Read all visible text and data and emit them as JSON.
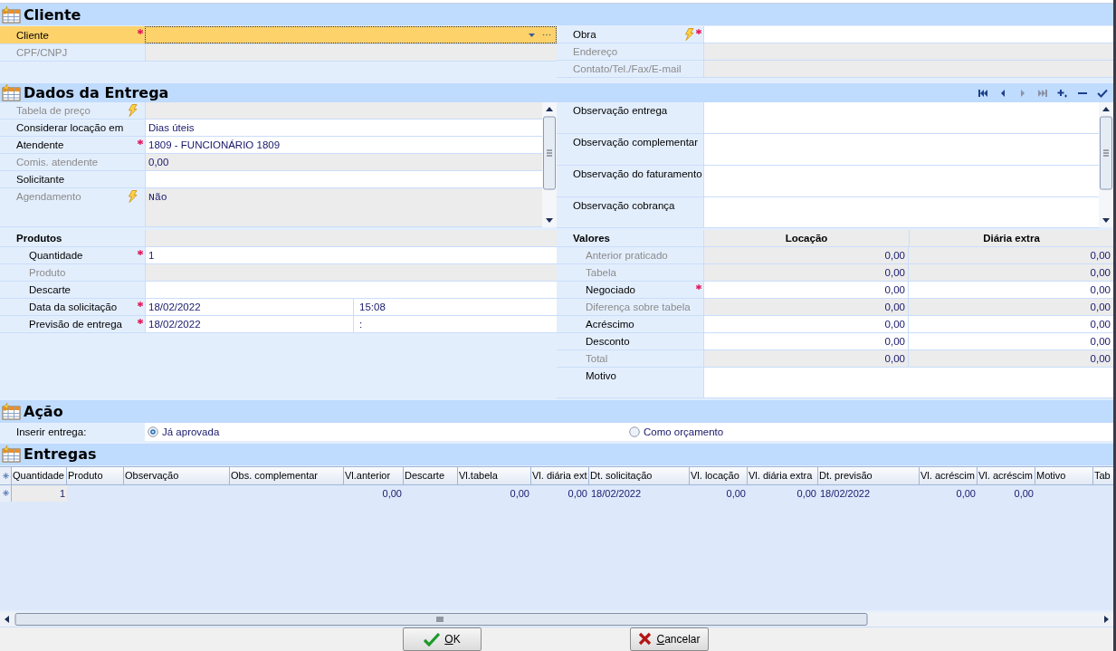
{
  "cliente": {
    "title": "Cliente",
    "left": [
      {
        "label": "Cliente",
        "kind": "lookup",
        "required": true,
        "action": false,
        "disabled": false,
        "focused": true
      },
      {
        "label": "CPF/CNPJ",
        "required": false,
        "action": false,
        "disabled": true,
        "focused": false
      }
    ],
    "right": [
      {
        "label": "Obra",
        "required": true,
        "action": true,
        "disabled": false
      },
      {
        "label": "Endereço",
        "required": false,
        "action": false,
        "disabled": true
      },
      {
        "label": "Contato/Tel./Fax/E-mail",
        "required": false,
        "action": false,
        "disabled": true
      }
    ]
  },
  "entrega": {
    "title": "Dados da Entrega",
    "navigator": [
      {
        "kind": "first",
        "disabled": false
      },
      {
        "kind": "prior",
        "disabled": false
      },
      {
        "kind": "next",
        "disabled": true
      },
      {
        "kind": "last",
        "disabled": true
      },
      {
        "kind": "insert",
        "disabled": false
      },
      {
        "kind": "delete",
        "disabled": false
      },
      {
        "kind": "post",
        "disabled": false
      }
    ],
    "left": [
      {
        "label": "Tabela de preço",
        "required": false,
        "action": true,
        "disabled": true
      },
      {
        "label": "Considerar locação em",
        "value": "Dias úteis",
        "required": false,
        "action": false,
        "disabled": false
      },
      {
        "label": "Atendente",
        "value": "1809 - FUNCIONÁRIO  1809",
        "required": true,
        "action": false,
        "disabled": false
      },
      {
        "label": "Comis. atendente",
        "value": "0,00",
        "required": false,
        "action": false,
        "disabled": true
      },
      {
        "label": "Solicitante",
        "required": false,
        "action": false,
        "disabled": false
      },
      {
        "label": "Agendamento",
        "value": "Não",
        "kind": "memo",
        "required": false,
        "action": true,
        "disabled": true
      }
    ],
    "right": [
      {
        "label": "Observação entrega"
      },
      {
        "label": "Observação complementar"
      },
      {
        "label": "Observação do faturamento"
      },
      {
        "label": "Observação cobrança"
      }
    ],
    "produtos": {
      "title": "Produtos",
      "rows": [
        {
          "label": "Quantidade",
          "value": "1",
          "required": true,
          "disabled": false
        },
        {
          "label": "Produto",
          "required": false,
          "disabled": true
        },
        {
          "label": "Descarte",
          "required": false,
          "disabled": false
        },
        {
          "label": "Data da solicitação",
          "value": "18/02/2022",
          "time": "15:08",
          "required": true,
          "disabled": false
        },
        {
          "label": "Previsão de entrega",
          "value": "18/02/2022",
          "time": ":",
          "required": true,
          "disabled": false
        }
      ]
    },
    "valores": {
      "title": "Valores",
      "columns": [
        "Locação",
        "Diária extra"
      ],
      "rows": [
        {
          "label": "Anterior praticado",
          "values": [
            "0,00",
            "0,00"
          ],
          "required": false,
          "disabled": true
        },
        {
          "label": "Tabela",
          "values": [
            "0,00",
            "0,00"
          ],
          "required": false,
          "disabled": true
        },
        {
          "label": "Negociado",
          "values": [
            "0,00",
            "0,00"
          ],
          "required": true,
          "disabled": false
        },
        {
          "label": "Diferença sobre tabela",
          "values": [
            "0,00",
            "0,00"
          ],
          "required": false,
          "disabled": true
        },
        {
          "label": "Acréscimo",
          "values": [
            "0,00",
            "0,00"
          ],
          "required": false,
          "disabled": false
        },
        {
          "label": "Desconto",
          "values": [
            "0,00",
            "0,00"
          ],
          "required": false,
          "disabled": false
        },
        {
          "label": "Total",
          "values": [
            "0,00",
            "0,00"
          ],
          "required": false,
          "disabled": true
        },
        {
          "label": "Motivo",
          "kind": "memo",
          "required": false,
          "disabled": false
        }
      ]
    }
  },
  "acao": {
    "title": "Ação",
    "label": "Inserir entrega:",
    "options": [
      {
        "label": "Já aprovada",
        "selected": true
      },
      {
        "label": "Como orçamento",
        "selected": false
      }
    ]
  },
  "entregas": {
    "title": "Entregas",
    "columns": [
      "Quantidade",
      "Produto",
      "Observação",
      "Obs. complementar",
      "Vl.anterior",
      "Descarte",
      "Vl.tabela",
      "Vl. diária ext",
      "Dt. solicitação",
      "Vl. locação",
      "Vl. diária extra",
      "Dt. previsão",
      "Vl. acréscim",
      "Vl. acréscim",
      "Motivo",
      "Tab"
    ],
    "rows": [
      [
        "1",
        null,
        null,
        null,
        "0,00",
        null,
        "0,00",
        "0,00",
        "18/02/2022",
        "0,00",
        "0,00",
        "18/02/2022",
        "0,00",
        "0,00",
        null,
        null
      ]
    ]
  },
  "buttons": [
    {
      "label": "OK",
      "kind": "ok"
    },
    {
      "label": "Cancelar",
      "kind": "cancel"
    }
  ]
}
